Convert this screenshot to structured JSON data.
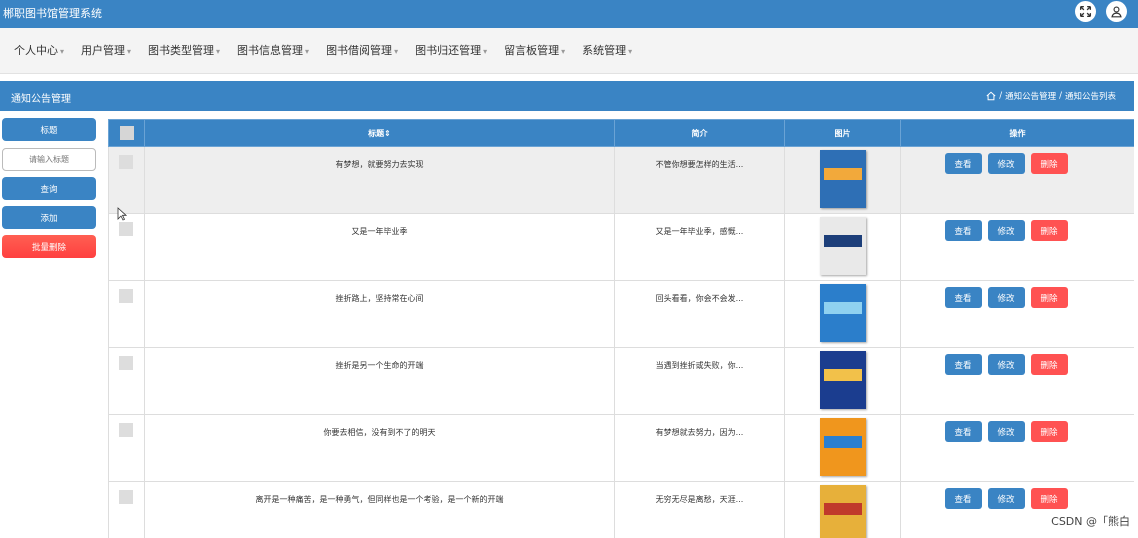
{
  "app": {
    "title": "郴职图书馆管理系统"
  },
  "top_icons": [
    {
      "icon": "fullscreen-icon"
    },
    {
      "icon": "user-icon"
    }
  ],
  "nav": {
    "items": [
      {
        "label": "个人中心"
      },
      {
        "label": "用户管理"
      },
      {
        "label": "图书类型管理"
      },
      {
        "label": "图书信息管理"
      },
      {
        "label": "图书借阅管理"
      },
      {
        "label": "图书归还管理"
      },
      {
        "label": "留言板管理"
      },
      {
        "label": "系统管理"
      }
    ]
  },
  "page": {
    "title": "通知公告管理",
    "breadcrumb": {
      "home_icon": "home-icon",
      "items": [
        "通知公告管理",
        "通知公告列表"
      ],
      "separator": "/"
    }
  },
  "sidebar": {
    "title_button": "标题",
    "search_placeholder": "请输入标题",
    "query_button": "查询",
    "add_button": "添加",
    "batch_delete_button": "批量删除"
  },
  "table": {
    "headers": {
      "title": "标题",
      "title_sort": "⇕",
      "brief": "简介",
      "picture": "图片",
      "actions": "操作"
    },
    "rows": [
      {
        "title": "有梦想，就要努力去实现",
        "brief": "不管你想要怎样的生活...",
        "cover": "#2e6fb5",
        "label": "#f2a93b"
      },
      {
        "title": "又是一年毕业季",
        "brief": "又是一年毕业季，感慨...",
        "cover": "#e9e9e9",
        "label": "#1d3f7a"
      },
      {
        "title": "挫折路上，坚持常在心间",
        "brief": "回头看看，你会不会发...",
        "cover": "#2b7ecb",
        "label": "#8fd1f0"
      },
      {
        "title": "挫折是另一个生命的开端",
        "brief": "当遇到挫折或失败，你...",
        "cover": "#1b3d8f",
        "label": "#f2c14a"
      },
      {
        "title": "你要去相信，没有到不了的明天",
        "brief": "有梦想就去努力，因为...",
        "cover": "#f0961d",
        "label": "#2a7fd0"
      },
      {
        "title": "离开是一种痛苦，是一种勇气，但同样也是一个考验，是一个新的开端",
        "brief": "无穷无尽是离愁，天涯...",
        "cover": "#e7b03a",
        "label": "#c0392b"
      }
    ],
    "actions": {
      "view": "查看",
      "edit": "修改",
      "delete": "删除"
    }
  },
  "watermark": "CSDN @「熊白"
}
